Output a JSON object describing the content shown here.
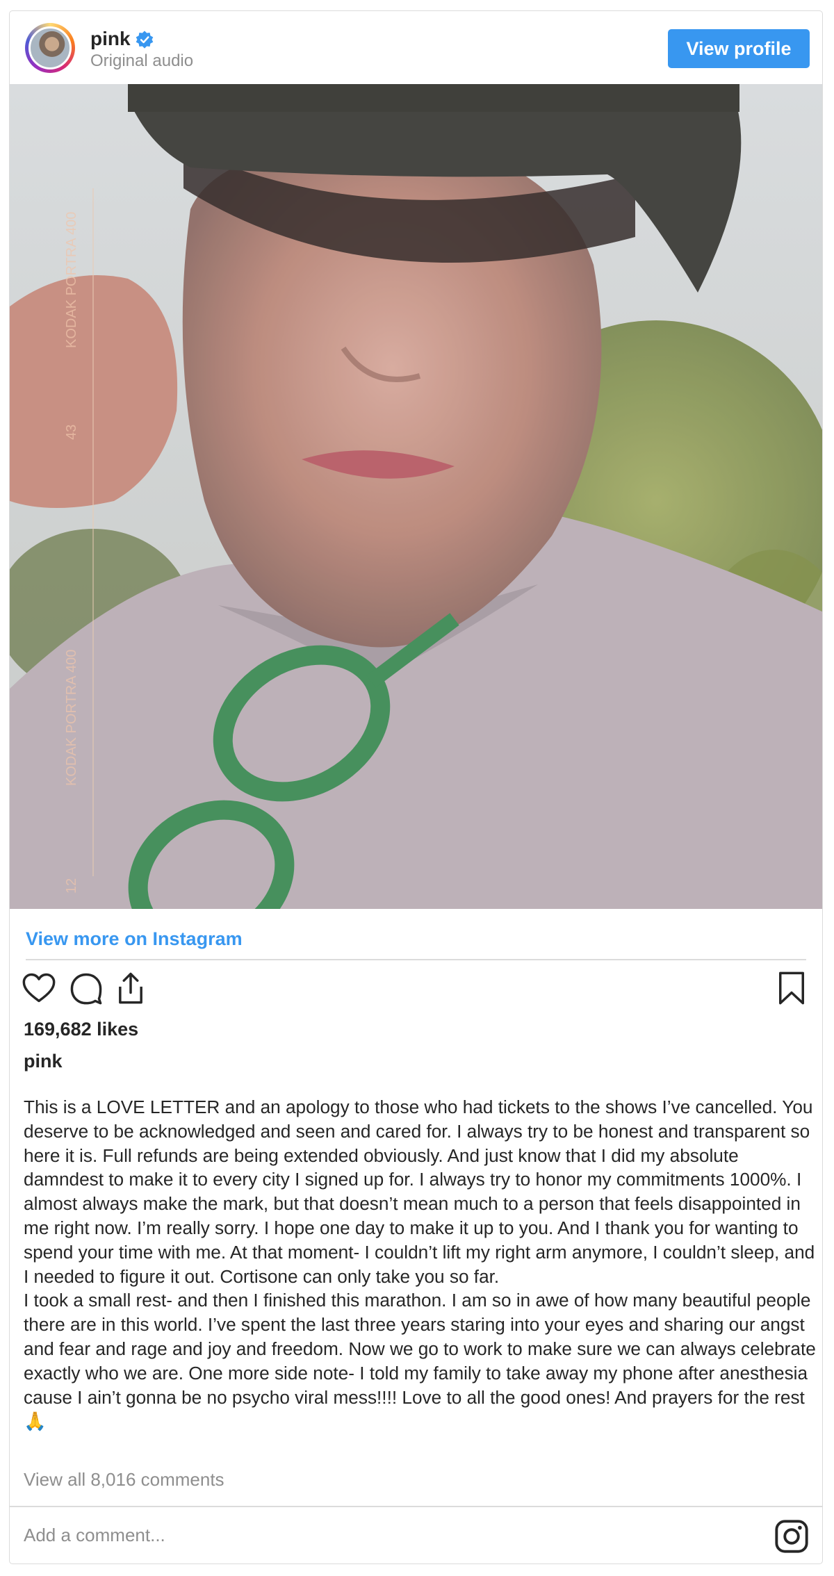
{
  "header": {
    "username": "pink",
    "subtitle": "Original audio",
    "view_profile_label": "View profile"
  },
  "media": {
    "film_labels": [
      "KODAK PORTRA 400",
      "43",
      "KODAK PORTRA 400",
      "12"
    ]
  },
  "links": {
    "view_more": "View more on Instagram"
  },
  "icons": {
    "like": "heart-icon",
    "comment": "comment-icon",
    "share": "share-icon",
    "save": "bookmark-icon",
    "verified": "verified-badge-icon",
    "instagram": "instagram-logo-icon"
  },
  "stats": {
    "likes": "169,682 likes"
  },
  "caption": {
    "username": "pink",
    "paragraph_1": "This is a LOVE LETTER and an apology to those who had tickets to the shows I’ve cancelled. You deserve to be acknowledged and seen and cared for. I always try to be honest and transparent so here it is. Full refunds are being extended obviously. And just know that I did my absolute damndest to make it to every city I signed up for. I always try to honor my commitments 1000%. I almost always make the mark, but that doesn’t mean much to a person that feels disappointed in me right now. I’m really sorry. I hope one day to make it up to you. And I thank you for wanting to spend your time with me. At that moment- I couldn’t lift my right arm anymore, I couldn’t sleep, and I needed to figure it out. Cortisone can only take you so far.",
    "paragraph_2": "I took a small rest- and then I finished this marathon. I am so in awe of how many beautiful people there are in this world. I’ve spent the last three years staring into your eyes and sharing our angst and fear and rage and joy and freedom. Now we go to work to make sure we can always celebrate exactly who we are. One more side note- I told my family to take away my phone after anesthesia cause I ain’t gonna be no psycho viral mess!!!! Love to all the good ones! And prayers for the rest 🙏"
  },
  "comments": {
    "view_all": "View all 8,016 comments",
    "add_placeholder": "Add a comment..."
  },
  "colors": {
    "accent": "#3897f0",
    "text": "#262626",
    "muted": "#8e8e8e",
    "border": "#dbdbdb"
  }
}
